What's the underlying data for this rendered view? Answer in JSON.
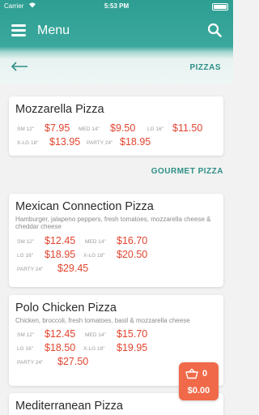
{
  "status_bar": {
    "carrier": "Carrier",
    "time": "5:53 PM"
  },
  "header": {
    "title": "Menu"
  },
  "subheader": {
    "breadcrumb": "PIZZAS"
  },
  "sections": [
    {
      "title": "GOURMET PIZZA"
    }
  ],
  "items": [
    {
      "name": "Mozzarella Pizza",
      "description": "",
      "prices": [
        {
          "size": "SM 12\"",
          "price": "$7.95"
        },
        {
          "size": "MED 14\"",
          "price": "$9.50"
        },
        {
          "size": "LG 16\"",
          "price": "$11.50"
        },
        {
          "size": "X-LG 18\"",
          "price": "$13.95"
        },
        {
          "size": "PARTY 24\"",
          "price": "$18.95"
        }
      ]
    },
    {
      "name": "Mexican Connection Pizza",
      "description": "Hamburger, jalapeno peppers, fresh tomatoes, mozzarella cheese & cheddar cheese",
      "prices": [
        {
          "size": "SM 12\"",
          "price": "$12.45"
        },
        {
          "size": "MED 14\"",
          "price": "$16.70"
        },
        {
          "size": "LG 16\"",
          "price": "$18.95"
        },
        {
          "size": "X-LG 18\"",
          "price": "$20.50"
        },
        {
          "size": "PARTY 24\"",
          "price": "$29.45"
        }
      ]
    },
    {
      "name": "Polo Chicken Pizza",
      "description": "Chicken, broccoli, fresh tomatoes, basil & mozzarella cheese",
      "prices": [
        {
          "size": "SM 12\"",
          "price": "$12.45"
        },
        {
          "size": "MED 14\"",
          "price": "$15.70"
        },
        {
          "size": "LG 16\"",
          "price": "$18.50"
        },
        {
          "size": "X-LG 18\"",
          "price": "$19.95"
        },
        {
          "size": "PARTY 24\"",
          "price": "$27.50"
        }
      ]
    },
    {
      "name": "Mediterranean Pizza",
      "description": "",
      "prices": []
    }
  ],
  "cart": {
    "count": "0",
    "total": "$0.00"
  },
  "colors": {
    "accent": "#2e8f86",
    "price": "#e0452f",
    "cart": "#f06a4a"
  },
  "icons": [
    "hamburger-menu-icon",
    "search-icon",
    "back-arrow-icon",
    "cart-icon",
    "wifi-icon",
    "battery-icon"
  ]
}
